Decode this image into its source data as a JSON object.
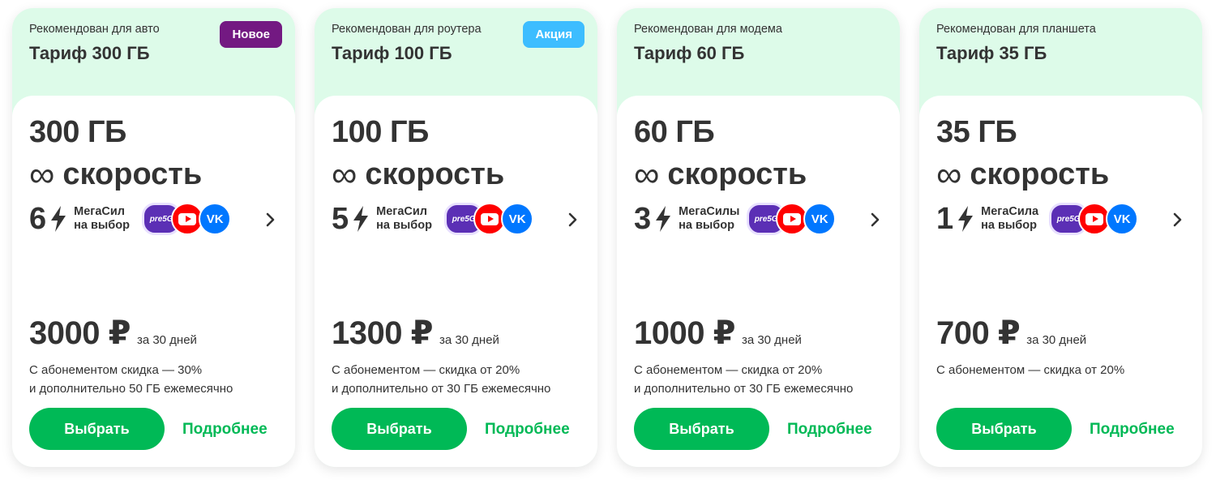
{
  "common": {
    "speed_label": "скорость",
    "infinity": "∞",
    "period": "за 30 дней",
    "choose_label": "Выбрать",
    "more_label": "Подробнее",
    "pre5g_label": "pre5G",
    "vk_label": "VK",
    "colors": {
      "accent_green": "#00b956",
      "head_bg": "#ddfbe9",
      "badge_new": "#731982",
      "badge_promo": "#3dbdff"
    }
  },
  "cards": [
    {
      "recommend": "Рекомендован для авто",
      "tariff": "Тариф 300 ГБ",
      "badge": "Новое",
      "gb": "300 ГБ",
      "power_count": "6",
      "power_label": "МегаСил на выбор",
      "price": "3000 ₽",
      "discount_line1": "С абонементом скидка — 30%",
      "discount_line2": "и дополнительно 50 ГБ ежемесячно"
    },
    {
      "recommend": "Рекомендован для роутера",
      "tariff": "Тариф 100 ГБ",
      "badge": "Акция",
      "gb": "100 ГБ",
      "power_count": "5",
      "power_label": "МегаСил на выбор",
      "price": "1300 ₽",
      "discount_line1": "С абонементом — скидка от 20%",
      "discount_line2": "и дополнительно от 30 ГБ ежемесячно"
    },
    {
      "recommend": "Рекомендован для модема",
      "tariff": "Тариф 60 ГБ",
      "badge": "",
      "gb": "60 ГБ",
      "power_count": "3",
      "power_label": "МегаСилы на выбор",
      "price": "1000 ₽",
      "discount_line1": "С абонементом — скидка от 20%",
      "discount_line2": "и дополнительно от 30 ГБ ежемесячно"
    },
    {
      "recommend": "Рекомендован для планшета",
      "tariff": "Тариф 35 ГБ",
      "badge": "",
      "gb": "35 ГБ",
      "power_count": "1",
      "power_label": "МегаСила на выбор",
      "price": "700 ₽",
      "discount_line1": "С абонементом — скидка от 20%",
      "discount_line2": ""
    }
  ]
}
